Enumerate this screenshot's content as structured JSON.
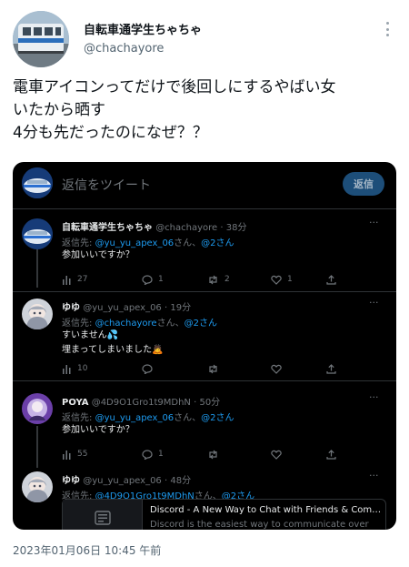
{
  "tweet": {
    "display_name": "自転車通学生ちゃちゃ",
    "handle": "@chachayore",
    "text_lines": [
      "電車アイコンってだけで後回しにするやばい女",
      "いたから晒す",
      "4分も先だったのになぜ？？"
    ],
    "timestamp": "2023年01月06日 10:45 午前",
    "more_icon": "more-vertical-icon"
  },
  "screenshot": {
    "reply_placeholder": "返信をツイート",
    "reply_button": "返信",
    "replies": [
      {
        "name": "自転車通学生ちゃちゃ",
        "handle": "@chachayore",
        "time": "38分",
        "reply_to_prefix": "返信先: ",
        "reply_to_handle": "@yu_yu_apex_06",
        "reply_to_mid": "さん、",
        "reply_to_others": "@2さん",
        "text_lines": [
          "参加いいですか？"
        ],
        "stats": {
          "views": "27",
          "replies": "1",
          "retweets": "2",
          "likes": "1"
        }
      },
      {
        "name": "ゆゆ",
        "handle": "@yu_yu_apex_06",
        "time": "19分",
        "reply_to_prefix": "返信先: ",
        "reply_to_handle": "@chachayore",
        "reply_to_mid": "さん、",
        "reply_to_others": "@2さん",
        "text_lines": [
          "すいません💦",
          "埋まってしまいました🙇"
        ],
        "stats": {
          "views": "10",
          "replies": "",
          "retweets": "",
          "likes": ""
        }
      },
      {
        "name": "POYA",
        "handle": "@4D9O1Gro1t9MDhN",
        "time": "50分",
        "reply_to_prefix": "返信先: ",
        "reply_to_handle": "@yu_yu_apex_06",
        "reply_to_mid": "さん、",
        "reply_to_others": "@2さん",
        "text_lines": [
          "参加いいですか？"
        ],
        "stats": {
          "views": "55",
          "replies": "1",
          "retweets": "",
          "likes": ""
        }
      },
      {
        "name": "ゆゆ",
        "handle": "@yu_yu_apex_06",
        "time": "48分",
        "reply_to_prefix": "返信先: ",
        "reply_to_handle": "@4D9O1Gro1t9MDhN",
        "reply_to_mid": "さん、",
        "reply_to_others": "@2さん",
        "text_lines": [],
        "stats": null
      }
    ],
    "card": {
      "title": "Discord - A New Way to Chat with Friends & Com…",
      "description": "Discord is the easiest way to communicate over"
    }
  }
}
